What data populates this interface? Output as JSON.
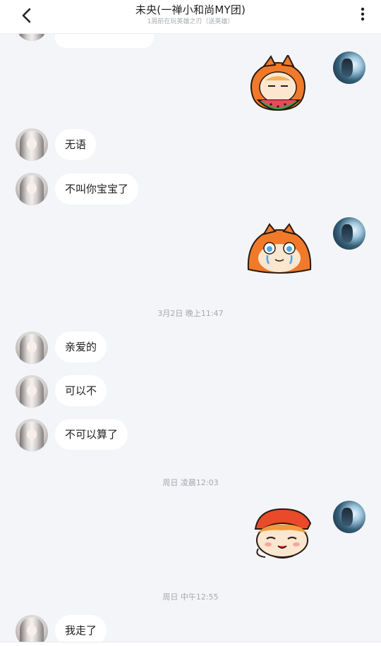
{
  "header": {
    "title": "未央(一禅小和尚MY团)",
    "status": "1周前在玩英雄之刃（送英雄）"
  },
  "icons": {
    "back": "chevron-left-icon",
    "more": "vertical-dots-icon"
  },
  "colors": {
    "background": "#f3f5f8",
    "bubble": "#ffffff",
    "sticker_orange": "#f07a2a"
  },
  "messages": {
    "m1": "无语",
    "m2": "不叫你宝宝了",
    "m3": "亲爱的",
    "m4": "可以不",
    "m5": "不可以算了",
    "m6": "我走了"
  },
  "timestamps": {
    "t1": "3月2日 晚上11:47",
    "t2": "周日 凌晨12:03",
    "t3": "周日 中午12:55"
  }
}
